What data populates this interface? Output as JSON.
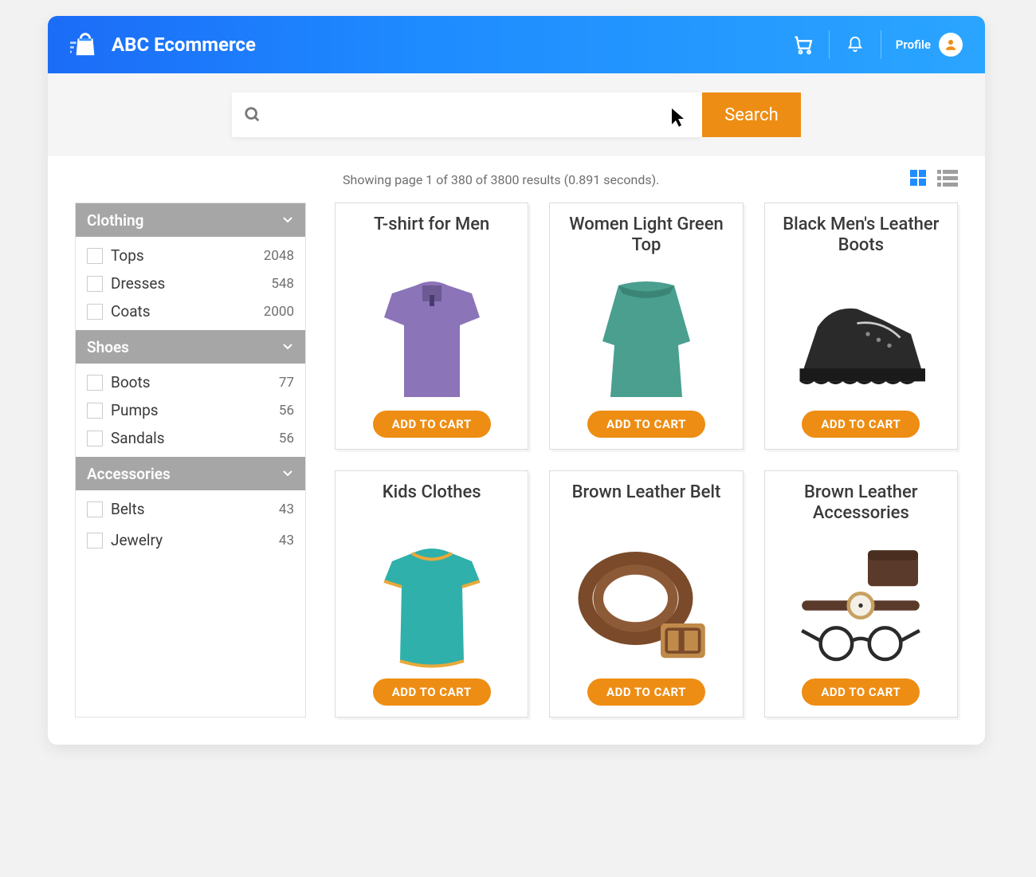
{
  "header": {
    "brand": "ABC Ecommerce",
    "profile_label": "Profile"
  },
  "search": {
    "placeholder": "",
    "value": "",
    "button_label": "Search"
  },
  "results": {
    "text": "Showing page 1 of 380 of 3800 results (0.891 seconds)."
  },
  "facets": [
    {
      "title": "Clothing",
      "items": [
        {
          "label": "Tops",
          "count": "2048"
        },
        {
          "label": "Dresses",
          "count": "548"
        },
        {
          "label": "Coats",
          "count": "2000"
        }
      ]
    },
    {
      "title": "Shoes",
      "items": [
        {
          "label": "Boots",
          "count": "77"
        },
        {
          "label": "Pumps",
          "count": "56"
        },
        {
          "label": "Sandals",
          "count": "56"
        }
      ]
    },
    {
      "title": "Accessories",
      "items": [
        {
          "label": "Belts",
          "count": "43"
        },
        {
          "label": "Jewelry",
          "count": "43"
        }
      ]
    }
  ],
  "products": [
    {
      "title": "T-shirt for Men",
      "cta": "ADD TO CART"
    },
    {
      "title": "Women Light Green Top",
      "cta": "ADD TO CART"
    },
    {
      "title": "Black Men's Leather Boots",
      "cta": "ADD TO CART"
    },
    {
      "title": "Kids Clothes",
      "cta": "ADD TO CART"
    },
    {
      "title": "Brown Leather Belt",
      "cta": "ADD TO CART"
    },
    {
      "title": "Brown Leather Accessories",
      "cta": "ADD TO CART"
    }
  ],
  "colors": {
    "accent": "#ee8d13",
    "header_gradient_start": "#1b6cf7",
    "header_gradient_end": "#2aa5ff",
    "sidebar_header": "#a6a6a6",
    "grid_active": "#1f8cff"
  }
}
